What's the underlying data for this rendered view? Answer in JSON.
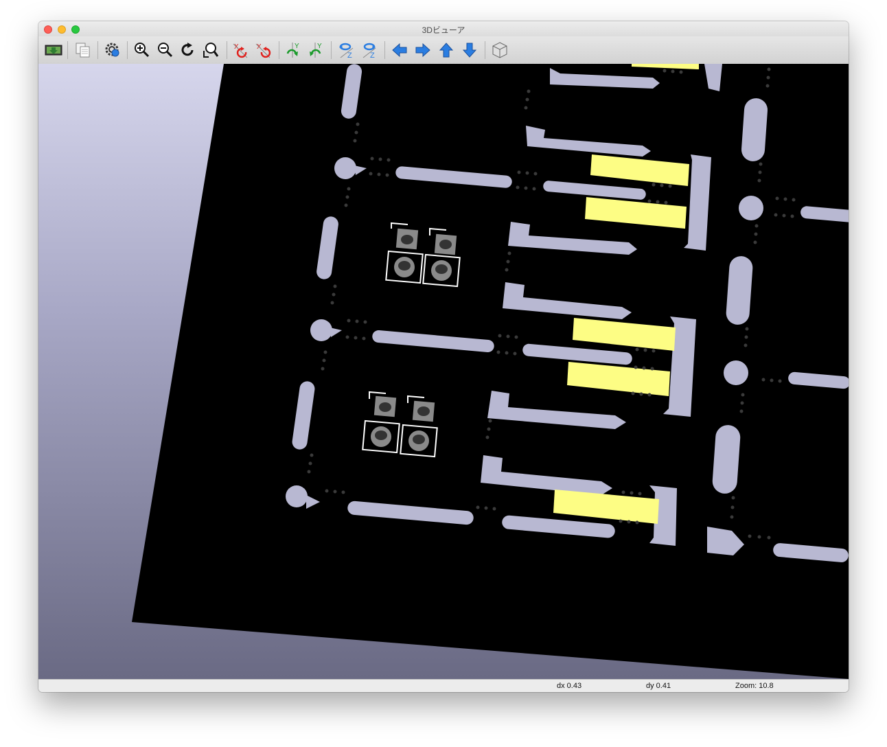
{
  "window": {
    "title": "3Dビューア"
  },
  "toolbar": {
    "buttons": [
      {
        "name": "reload-board",
        "icon": "reload-board-icon"
      },
      {
        "name": "copy-image",
        "icon": "copy-icon"
      },
      {
        "name": "settings",
        "icon": "gear-icon"
      },
      {
        "name": "zoom-in",
        "icon": "zoom-in-icon"
      },
      {
        "name": "zoom-out",
        "icon": "zoom-out-icon"
      },
      {
        "name": "redraw",
        "icon": "refresh-icon"
      },
      {
        "name": "zoom-fit",
        "icon": "zoom-fit-icon"
      },
      {
        "name": "rotate-x-cw",
        "icon": "rotate-x-icon",
        "label": "X"
      },
      {
        "name": "rotate-x-ccw",
        "icon": "rotate-x-icon",
        "label": "X"
      },
      {
        "name": "rotate-y-cw",
        "icon": "rotate-y-icon",
        "label": "Y"
      },
      {
        "name": "rotate-y-ccw",
        "icon": "rotate-y-icon",
        "label": "Y"
      },
      {
        "name": "rotate-z-cw",
        "icon": "rotate-z-icon",
        "label": "Z"
      },
      {
        "name": "rotate-z-ccw",
        "icon": "rotate-z-icon",
        "label": "Z"
      },
      {
        "name": "move-left",
        "icon": "arrow-left-icon"
      },
      {
        "name": "move-right",
        "icon": "arrow-right-icon"
      },
      {
        "name": "move-up",
        "icon": "arrow-up-icon"
      },
      {
        "name": "move-down",
        "icon": "arrow-down-icon"
      },
      {
        "name": "toggle-projection",
        "icon": "cube-icon"
      }
    ]
  },
  "status": {
    "dx": "dx 0.43",
    "dy": "dy 0.41",
    "zoom": "Zoom: 10.8"
  },
  "colors": {
    "board": "#000000",
    "copper": "#b8b8d2",
    "pad_yellow": "#fdfd84",
    "background_top": "#d6d6ec",
    "background_bottom": "#6a6a84",
    "icon_blue": "#2a7de1",
    "icon_red": "#e0201c",
    "icon_green": "#1a9a2a"
  }
}
